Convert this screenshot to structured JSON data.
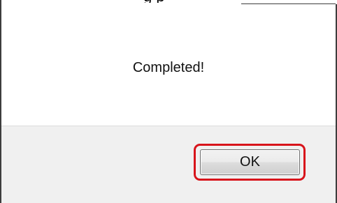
{
  "dialog": {
    "top_partial_text": "g p",
    "message": "Completed!",
    "ok_button_label": "OK"
  },
  "colors": {
    "highlight": "#d8141b",
    "footer_background": "#f0f0f0",
    "dialog_background": "#ffffff",
    "border": "#3d3d3d"
  }
}
